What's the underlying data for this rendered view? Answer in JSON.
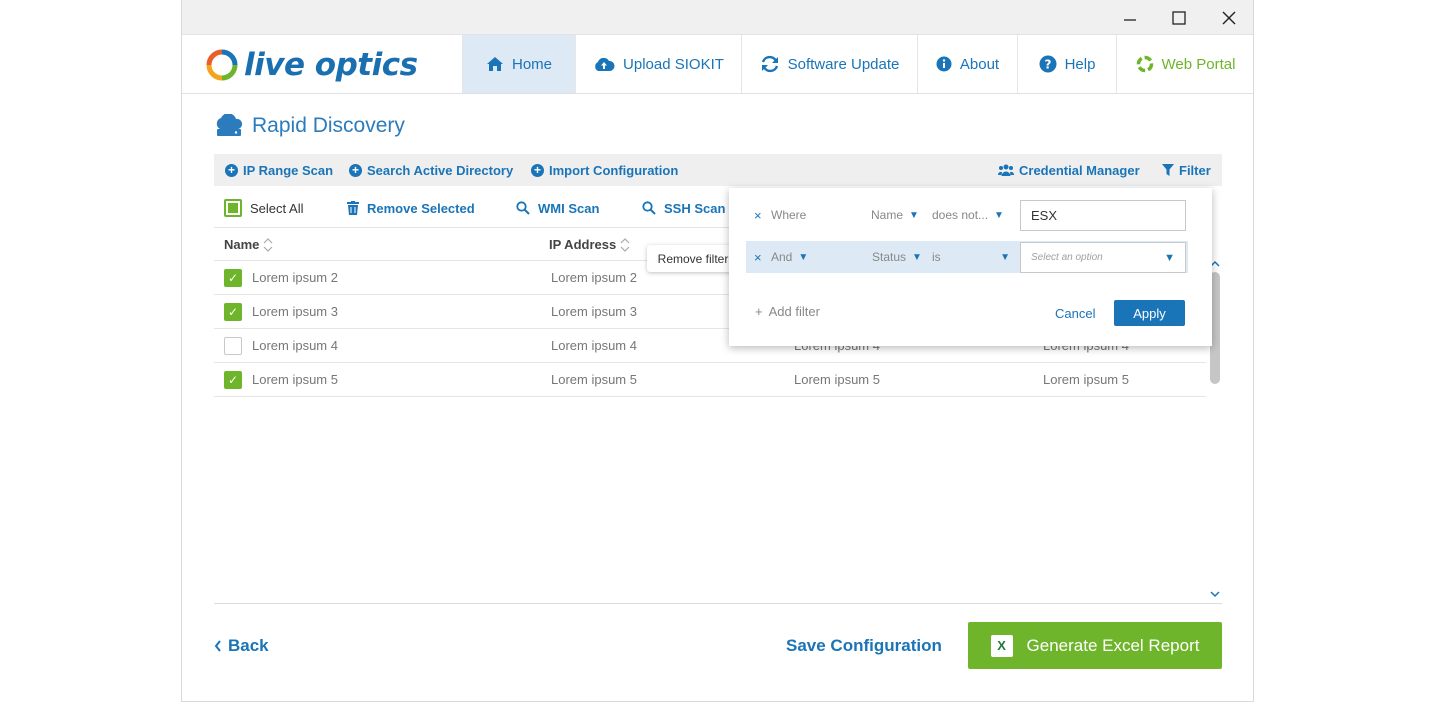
{
  "window": {
    "minimize": "–",
    "maximize": "☐",
    "close": "✕"
  },
  "logo": {
    "text": "live optics"
  },
  "nav": [
    {
      "label": "Home",
      "icon": "home-icon"
    },
    {
      "label": "Upload SIOKIT",
      "icon": "cloud-upload-icon"
    },
    {
      "label": "Software Update",
      "icon": "refresh-icon"
    },
    {
      "label": "About",
      "icon": "info-icon"
    },
    {
      "label": "Help",
      "icon": "help-icon"
    },
    {
      "label": "Web Portal",
      "icon": "web-portal-icon"
    }
  ],
  "page": {
    "title": "Rapid Discovery"
  },
  "toolbar": {
    "ip_range": "IP Range Scan",
    "search_ad": "Search Active Directory",
    "import": "Import Configuration",
    "credential": "Credential Manager",
    "filter": "Filter"
  },
  "actions": {
    "select_all": "Select All",
    "remove": "Remove Selected",
    "wmi": "WMI Scan",
    "ssh": "SSH Scan"
  },
  "table": {
    "headers": [
      "Name",
      "IP Address"
    ],
    "rows": [
      {
        "checked": true,
        "cells": [
          "Lorem ipsum 2",
          "Lorem ipsum 2",
          "",
          ""
        ]
      },
      {
        "checked": true,
        "cells": [
          "Lorem ipsum 3",
          "Lorem ipsum 3",
          "",
          ""
        ]
      },
      {
        "checked": false,
        "cells": [
          "Lorem ipsum 4",
          "Lorem ipsum 4",
          "Lorem ipsum 4",
          "Lorem ipsum 4"
        ]
      },
      {
        "checked": true,
        "cells": [
          "Lorem ipsum 5",
          "Lorem ipsum 5",
          "Lorem ipsum 5",
          "Lorem ipsum 5"
        ]
      }
    ]
  },
  "tooltip": "Remove filter",
  "filter_panel": {
    "rows": [
      {
        "remove": "×",
        "conj": "Where",
        "field": "Name",
        "op": "does not...",
        "value": "ESX"
      },
      {
        "remove": "×",
        "conj": "And",
        "field": "Status",
        "op": "is",
        "placeholder": "Select an option"
      }
    ],
    "add_filter": "Add filter",
    "cancel": "Cancel",
    "apply": "Apply"
  },
  "footer": {
    "back": "Back",
    "save": "Save Configuration",
    "generate": "Generate Excel Report"
  },
  "colors": {
    "brand_blue": "#1a74b8",
    "brand_green": "#6fb52b",
    "nav_active": "#dde9f4"
  }
}
